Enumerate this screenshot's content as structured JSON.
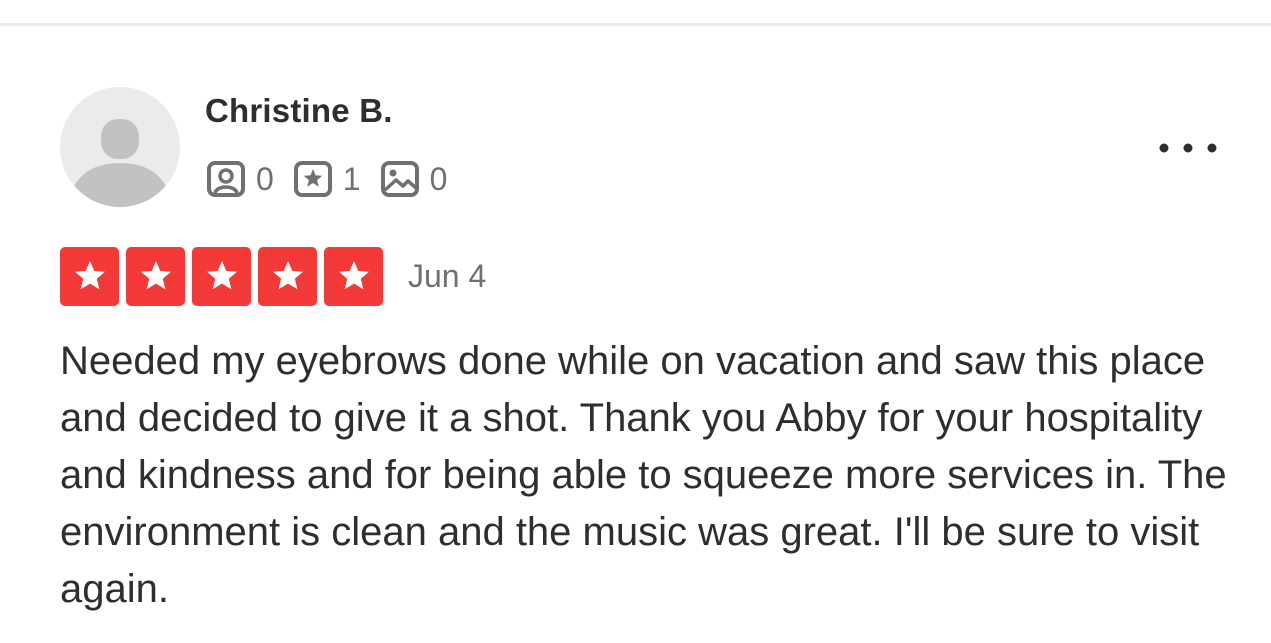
{
  "review": {
    "user": {
      "name": "Christine B.",
      "avatar_icon": "default-user-avatar",
      "stats": {
        "friends": "0",
        "reviews": "1",
        "photos": "0"
      }
    },
    "rating": 5,
    "rating_max": 5,
    "date": "Jun 4",
    "text": "Needed my eyebrows done while on vacation and saw this place and decided to give it a shot. Thank you Abby for your hospitality and kindness and for being able to squeeze more services in. The environment is clean and the music was great. I'll be sure to visit again."
  },
  "icons": {
    "friends": "friends-icon",
    "reviews": "review-star-icon",
    "photos": "photo-icon",
    "more": "more-options-icon",
    "star": "star-icon"
  },
  "colors": {
    "star_background": "#f43939",
    "text_primary": "#2d2e2f",
    "text_secondary": "#6e7072",
    "divider": "#ebebeb",
    "avatar_background": "#ebebec"
  }
}
